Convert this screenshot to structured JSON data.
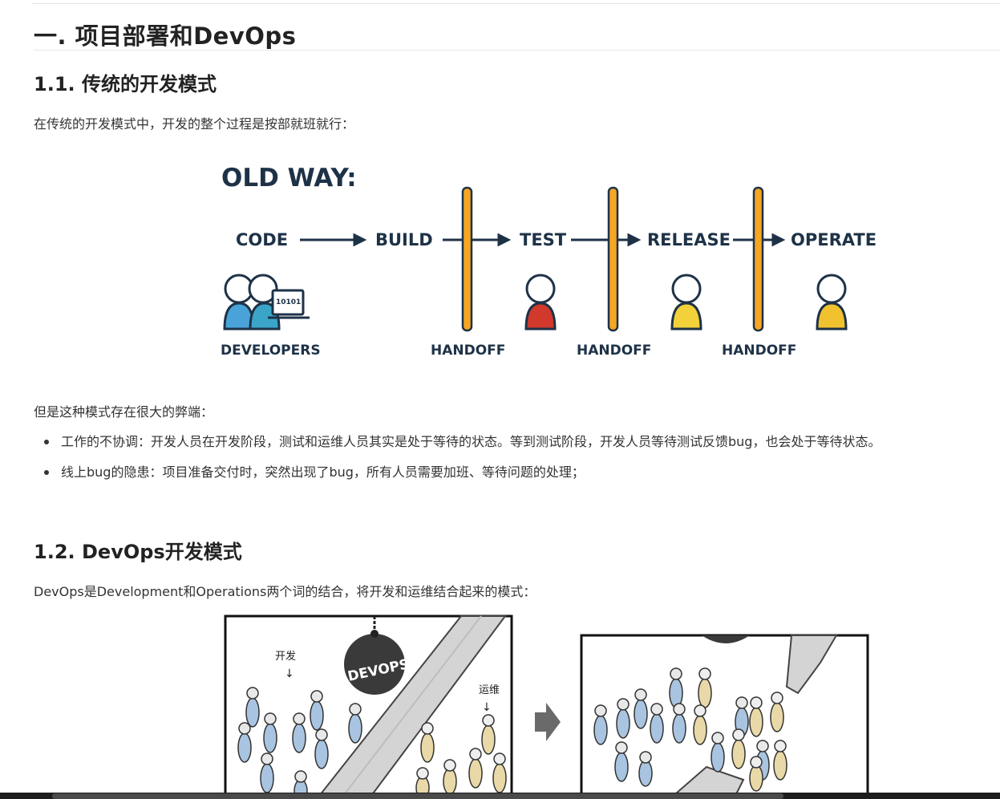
{
  "title": "一. 项目部署和DevOps",
  "section1": {
    "heading": "1.1. 传统的开发模式",
    "intro": "在传统的开发模式中，开发的整个过程是按部就班就行：",
    "diagram": {
      "title": "OLD WAY:",
      "stages": [
        "CODE",
        "BUILD",
        "TEST",
        "RELEASE",
        "OPERATE"
      ],
      "developers_label": "DEVELOPERS",
      "laptop_text": "10101",
      "handoff_labels": [
        "HANDOFF",
        "HANDOFF",
        "HANDOFF"
      ],
      "colors": {
        "text": "#1e3247",
        "handoff_bar": "#f5a623",
        "developer": "#4aa3d8",
        "tester": "#d0392b",
        "release": "#f2d13a",
        "operate": "#f2c12e"
      }
    },
    "problems_intro": "但是这种模式存在很大的弊端：",
    "problems": [
      "工作的不协调：开发人员在开发阶段，测试和运维人员其实是处于等待的状态。等到测试阶段，开发人员等待测试反馈bug，也会处于等待状态。",
      "线上bug的隐患：项目准备交付时，突然出现了bug，所有人员需要加班、等待问题的处理；"
    ]
  },
  "section2": {
    "heading": "1.2. DevOps开发模式",
    "intro": "DevOps是Development和Operations两个词的结合，将开发和运维结合起来的模式：",
    "comic": {
      "dev_label": "开发",
      "ops_label": "运维",
      "ball_text": "DEVOPS",
      "colors": {
        "dev": "#a9c4e0",
        "ops": "#e9d9a8"
      }
    }
  }
}
